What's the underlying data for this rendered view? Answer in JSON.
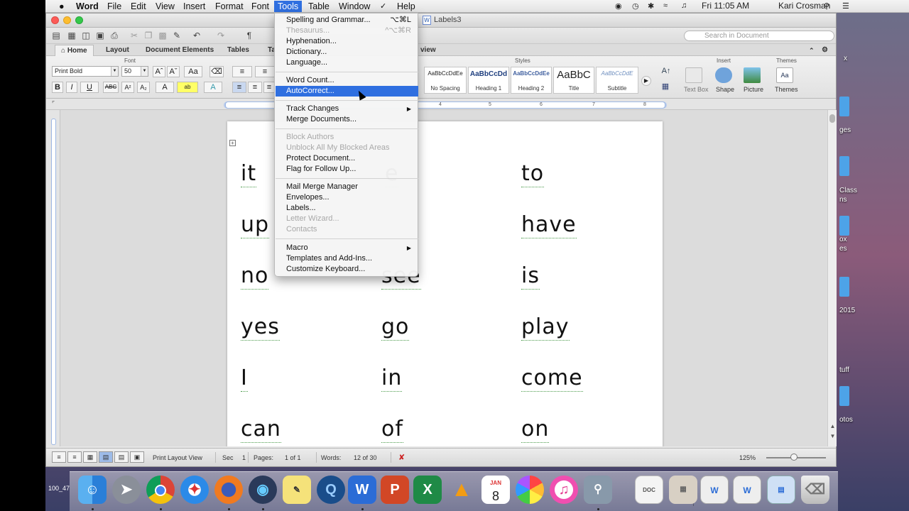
{
  "menubar": {
    "apple": "",
    "app": "Word",
    "items": [
      "File",
      "Edit",
      "View",
      "Insert",
      "Format",
      "Font",
      "Tools",
      "Table",
      "Window",
      "Help"
    ],
    "clock": "Fri 11:05 AM",
    "user": "Kari Crosman"
  },
  "window": {
    "title": "Labels3",
    "search_placeholder": "Search in Document"
  },
  "ribbon": {
    "tabs": [
      "Home",
      "Layout",
      "Document Elements",
      "Tables",
      "Ta",
      "view"
    ],
    "groups": {
      "font": "Font",
      "styles": "Styles",
      "insert": "Insert",
      "themes": "Themes"
    },
    "font_name": "Print Bold",
    "font_size": "50",
    "styles": [
      {
        "sample": "AaBbCcDdEe",
        "name": "No Spacing"
      },
      {
        "sample": "AaBbCcDd",
        "name": "Heading 1"
      },
      {
        "sample": "AaBbCcDdEe",
        "name": "Heading 2"
      },
      {
        "sample": "AaBbC",
        "name": "Title"
      },
      {
        "sample": "AaBbCcDdE",
        "name": "Subtitle"
      }
    ],
    "insert_items": [
      "Text Box",
      "Shape",
      "Picture"
    ],
    "themes_label": "Themes"
  },
  "ruler": {
    "numbers": [
      "4",
      "5",
      "6",
      "7",
      "8"
    ]
  },
  "document": {
    "words": [
      [
        "it",
        "e",
        "to"
      ],
      [
        "up",
        "",
        "have"
      ],
      [
        "no",
        "see",
        "is"
      ],
      [
        "yes",
        "go",
        "play"
      ],
      [
        "I",
        "in",
        "come"
      ],
      [
        "can",
        "of",
        "on"
      ]
    ]
  },
  "tools_menu": {
    "items": [
      {
        "label": "Spelling and Grammar...",
        "shortcut": "⌥⌘L",
        "disabled": false
      },
      {
        "label": "Thesaurus...",
        "shortcut": "^⌥⌘R",
        "disabled": true
      },
      {
        "label": "Hyphenation...",
        "disabled": false
      },
      {
        "label": "Dictionary...",
        "disabled": false
      },
      {
        "label": "Language...",
        "disabled": false
      },
      {
        "label": "Word Count...",
        "disabled": false
      },
      {
        "label": "AutoCorrect...",
        "disabled": false,
        "highlighted": true
      },
      {
        "label": "Track Changes",
        "submenu": true,
        "disabled": false
      },
      {
        "label": "Merge Documents...",
        "disabled": false
      },
      {
        "label": "Block Authors",
        "disabled": true
      },
      {
        "label": "Unblock All My Blocked Areas",
        "disabled": true
      },
      {
        "label": "Protect Document...",
        "disabled": false
      },
      {
        "label": "Flag for Follow Up...",
        "disabled": false
      },
      {
        "label": "Mail Merge Manager",
        "disabled": false
      },
      {
        "label": "Envelopes...",
        "disabled": false
      },
      {
        "label": "Labels...",
        "disabled": false
      },
      {
        "label": "Letter Wizard...",
        "disabled": true
      },
      {
        "label": "Contacts",
        "disabled": true
      },
      {
        "label": "Macro",
        "submenu": true,
        "disabled": false
      },
      {
        "label": "Templates and Add-Ins...",
        "disabled": false
      },
      {
        "label": "Customize Keyboard...",
        "disabled": false
      }
    ]
  },
  "statusbar": {
    "view": "Print Layout View",
    "sec_label": "Sec",
    "sec": "1",
    "pages_label": "Pages:",
    "pages": "1 of 1",
    "words_label": "Words:",
    "words": "12 of 30",
    "zoom": "125%"
  },
  "desktop": {
    "labels": [
      "x",
      "ges",
      "Class",
      "ns",
      "ox",
      "es",
      "2015",
      "tuff",
      "otos"
    ],
    "left_label": "100_47"
  },
  "dock": {
    "calendar_month": "JAN",
    "calendar_day": "8"
  }
}
